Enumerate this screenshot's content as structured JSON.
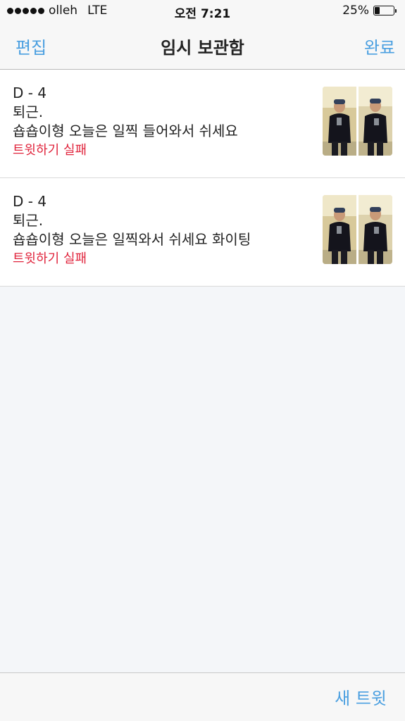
{
  "status_bar": {
    "carrier": "olleh",
    "network": "LTE",
    "time": "오전 7:21",
    "battery_percent_label": "25%",
    "battery_level": 0.25
  },
  "nav": {
    "left_label": "편집",
    "title": "임시 보관함",
    "right_label": "완료"
  },
  "drafts": [
    {
      "lines": [
        "D - 4",
        "퇴근.",
        "숍숍이형 오늘은 일찍 들어와서 쉬세요"
      ],
      "status": "트윗하기 실패"
    },
    {
      "lines": [
        "D - 4",
        "퇴근.",
        "숍숍이형 오늘은 일찍와서 쉬세요 화이팅"
      ],
      "status": "트윗하기 실패"
    }
  ],
  "bottom_bar": {
    "new_tweet_label": "새 트윗"
  },
  "colors": {
    "accent": "#4a9fe0",
    "error": "#e0243c"
  }
}
